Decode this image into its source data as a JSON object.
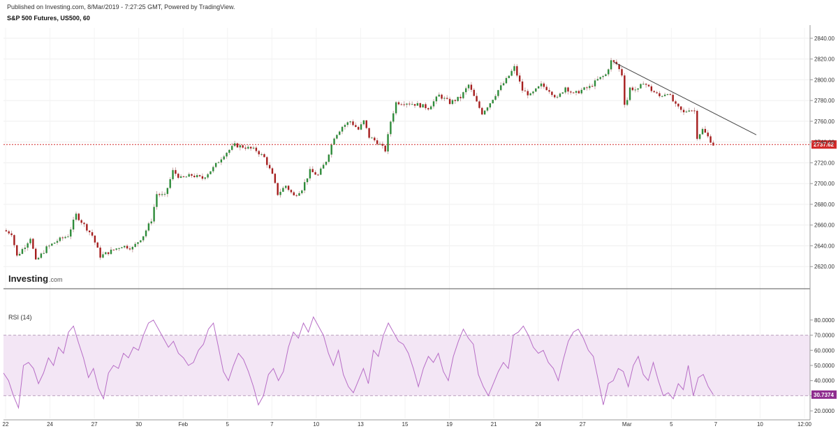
{
  "header": {
    "published": "Published on Investing.com, 8/Mar/2019 - 7:27:25 GMT, Powered by TradingView.",
    "title": "S&P 500 Futures, US500, 60"
  },
  "watermark": {
    "brand": "Investing",
    "suffix": ".com"
  },
  "colors": {
    "up": "#2e8b3a",
    "down": "#a51d1d",
    "rsi": "#b76dc6",
    "rsi_band": "#f3e6f5",
    "last": "#d22a2a",
    "rsi_badge": "#8e2c8e"
  },
  "chart_data": [
    {
      "type": "candlestick",
      "title": "S&P 500 Futures, US500, 60",
      "ylim": [
        2600,
        2850
      ],
      "y_ticks": [
        "2620.00",
        "2640.00",
        "2660.00",
        "2680.00",
        "2700.00",
        "2720.00",
        "2740.00",
        "2760.00",
        "2780.00",
        "2800.00",
        "2820.00",
        "2840.00"
      ],
      "last_price": "2737.62",
      "x_ticks": [
        "22",
        "24",
        "27",
        "30",
        "Feb",
        "5",
        "7",
        "10",
        "13",
        "15",
        "19",
        "21",
        "24",
        "27",
        "Mar",
        "5",
        "7",
        "10",
        "12:00"
      ],
      "close_path": [
        {
          "x": 0,
          "y": 2655
        },
        {
          "x": 1.5,
          "y": 2652
        },
        {
          "x": 2.5,
          "y": 2630
        },
        {
          "x": 4,
          "y": 2640
        },
        {
          "x": 5,
          "y": 2648
        },
        {
          "x": 6,
          "y": 2625
        },
        {
          "x": 8,
          "y": 2638
        },
        {
          "x": 10,
          "y": 2645
        },
        {
          "x": 12,
          "y": 2650
        },
        {
          "x": 13.5,
          "y": 2670
        },
        {
          "x": 15,
          "y": 2660
        },
        {
          "x": 16.5,
          "y": 2650
        },
        {
          "x": 18,
          "y": 2630
        },
        {
          "x": 20,
          "y": 2635
        },
        {
          "x": 22,
          "y": 2640
        },
        {
          "x": 24,
          "y": 2638
        },
        {
          "x": 26,
          "y": 2650
        },
        {
          "x": 27.5,
          "y": 2665
        },
        {
          "x": 28.5,
          "y": 2690
        },
        {
          "x": 30,
          "y": 2688
        },
        {
          "x": 31.5,
          "y": 2712
        },
        {
          "x": 33,
          "y": 2705
        },
        {
          "x": 35,
          "y": 2708
        },
        {
          "x": 37,
          "y": 2705
        },
        {
          "x": 39,
          "y": 2715
        },
        {
          "x": 41,
          "y": 2728
        },
        {
          "x": 43,
          "y": 2737
        },
        {
          "x": 45,
          "y": 2735
        },
        {
          "x": 47,
          "y": 2732
        },
        {
          "x": 48.5,
          "y": 2725
        },
        {
          "x": 50,
          "y": 2708
        },
        {
          "x": 51,
          "y": 2690
        },
        {
          "x": 52.5,
          "y": 2698
        },
        {
          "x": 54,
          "y": 2688
        },
        {
          "x": 55.5,
          "y": 2695
        },
        {
          "x": 57,
          "y": 2712
        },
        {
          "x": 58.5,
          "y": 2708
        },
        {
          "x": 60,
          "y": 2722
        },
        {
          "x": 61.5,
          "y": 2745
        },
        {
          "x": 63,
          "y": 2755
        },
        {
          "x": 64.5,
          "y": 2760
        },
        {
          "x": 66,
          "y": 2752
        },
        {
          "x": 67,
          "y": 2760
        },
        {
          "x": 68,
          "y": 2745
        },
        {
          "x": 69.5,
          "y": 2740
        },
        {
          "x": 71,
          "y": 2732
        },
        {
          "x": 72,
          "y": 2760
        },
        {
          "x": 73,
          "y": 2778
        },
        {
          "x": 75,
          "y": 2778
        },
        {
          "x": 77,
          "y": 2776
        },
        {
          "x": 79,
          "y": 2773
        },
        {
          "x": 81,
          "y": 2785
        },
        {
          "x": 83,
          "y": 2778
        },
        {
          "x": 85,
          "y": 2783
        },
        {
          "x": 86.5,
          "y": 2795
        },
        {
          "x": 88,
          "y": 2778
        },
        {
          "x": 89,
          "y": 2768
        },
        {
          "x": 90.5,
          "y": 2778
        },
        {
          "x": 92,
          "y": 2790
        },
        {
          "x": 93.5,
          "y": 2800
        },
        {
          "x": 95,
          "y": 2812
        },
        {
          "x": 96.5,
          "y": 2790
        },
        {
          "x": 98,
          "y": 2785
        },
        {
          "x": 100,
          "y": 2795
        },
        {
          "x": 101.5,
          "y": 2790
        },
        {
          "x": 103,
          "y": 2782
        },
        {
          "x": 104.5,
          "y": 2793
        },
        {
          "x": 106,
          "y": 2786
        },
        {
          "x": 107.5,
          "y": 2790
        },
        {
          "x": 109,
          "y": 2793
        },
        {
          "x": 110.5,
          "y": 2800
        },
        {
          "x": 112,
          "y": 2805
        },
        {
          "x": 113,
          "y": 2818
        },
        {
          "x": 114,
          "y": 2815
        },
        {
          "x": 115,
          "y": 2805
        },
        {
          "x": 115.6,
          "y": 2772
        },
        {
          "x": 116.5,
          "y": 2792
        },
        {
          "x": 118,
          "y": 2790
        },
        {
          "x": 119,
          "y": 2798
        },
        {
          "x": 120.5,
          "y": 2790
        },
        {
          "x": 122,
          "y": 2784
        },
        {
          "x": 123.5,
          "y": 2788
        },
        {
          "x": 125,
          "y": 2775
        },
        {
          "x": 126.5,
          "y": 2768
        },
        {
          "x": 127.5,
          "y": 2772
        },
        {
          "x": 128.5,
          "y": 2770
        },
        {
          "x": 129,
          "y": 2745
        },
        {
          "x": 130,
          "y": 2752
        },
        {
          "x": 131,
          "y": 2745
        },
        {
          "x": 132,
          "y": 2737.62
        }
      ],
      "trendline": [
        {
          "x": 113.5,
          "y": 2817
        },
        {
          "x": 140,
          "y": 2747
        }
      ]
    },
    {
      "type": "line",
      "title": "RSI (14)",
      "series": [
        {
          "name": "RSI (14)"
        }
      ],
      "ylim": [
        15,
        85
      ],
      "y_ticks": [
        "20.0000",
        "30.0000",
        "40.0000",
        "50.0000",
        "60.0000",
        "70.0000",
        "80.0000"
      ],
      "bands": [
        30,
        70
      ],
      "last_value": "30.7374",
      "values": [
        45,
        40,
        30,
        22,
        50,
        52,
        48,
        38,
        45,
        55,
        50,
        62,
        58,
        72,
        76,
        65,
        55,
        42,
        48,
        35,
        28,
        45,
        50,
        48,
        58,
        55,
        62,
        60,
        70,
        78,
        80,
        74,
        68,
        62,
        66,
        58,
        55,
        50,
        52,
        60,
        64,
        74,
        78,
        62,
        46,
        40,
        50,
        58,
        54,
        46,
        36,
        24,
        30,
        44,
        48,
        40,
        46,
        62,
        72,
        68,
        78,
        72,
        82,
        76,
        70,
        58,
        50,
        60,
        44,
        36,
        32,
        40,
        48,
        38,
        60,
        56,
        70,
        78,
        72,
        66,
        64,
        58,
        48,
        36,
        48,
        56,
        52,
        58,
        46,
        40,
        56,
        66,
        74,
        68,
        64,
        44,
        36,
        30,
        38,
        46,
        52,
        48,
        70,
        72,
        76,
        70,
        62,
        58,
        60,
        52,
        48,
        40,
        54,
        66,
        72,
        74,
        68,
        60,
        56,
        40,
        24,
        38,
        40,
        48,
        46,
        36,
        50,
        56,
        44,
        40,
        52,
        40,
        30,
        32,
        28,
        38,
        34,
        50,
        30,
        42,
        44,
        36,
        30.7
      ]
    }
  ]
}
